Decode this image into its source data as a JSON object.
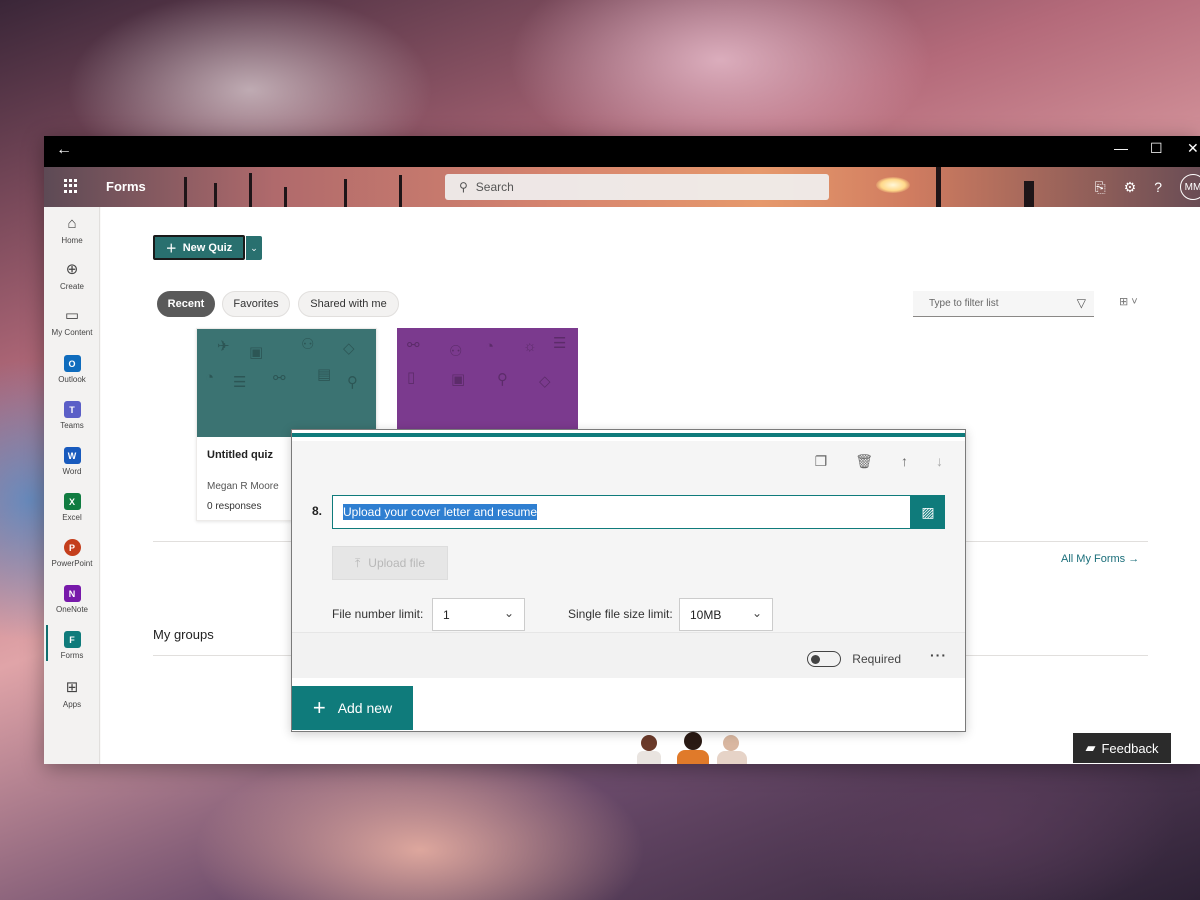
{
  "window": {
    "back_icon": "back-arrow-icon",
    "controls": [
      "minimize-icon",
      "maximize-icon",
      "close-icon"
    ]
  },
  "appbar": {
    "app_name": "Forms",
    "search_placeholder": "Search",
    "avatar_initials": "MM",
    "icons": [
      "app-launcher-icon",
      "search-icon",
      "whats-new-icon",
      "settings-icon",
      "help-icon"
    ]
  },
  "rail": {
    "items": [
      {
        "label": "Home",
        "icon": "home-icon"
      },
      {
        "label": "Create",
        "icon": "create-icon"
      },
      {
        "label": "My Content",
        "icon": "folder-icon"
      },
      {
        "label": "Outlook",
        "icon": "outlook-icon",
        "badge": "O",
        "color": "#0f6cbd"
      },
      {
        "label": "Teams",
        "icon": "teams-icon",
        "badge": "T",
        "color": "#5b5fc7"
      },
      {
        "label": "Word",
        "icon": "word-icon",
        "badge": "W",
        "color": "#185abd"
      },
      {
        "label": "Excel",
        "icon": "excel-icon",
        "badge": "X",
        "color": "#107c41"
      },
      {
        "label": "PowerPoint",
        "icon": "powerpoint-icon",
        "badge": "P",
        "color": "#c43e1c"
      },
      {
        "label": "OneNote",
        "icon": "onenote-icon",
        "badge": "N",
        "color": "#7719aa"
      },
      {
        "label": "Forms",
        "icon": "forms-icon",
        "badge": "F",
        "color": "#0f7b7b"
      },
      {
        "label": "Apps",
        "icon": "apps-icon"
      }
    ]
  },
  "main": {
    "new_button_label": "New Quiz",
    "tabs": [
      {
        "label": "Recent",
        "active": true
      },
      {
        "label": "Favorites",
        "active": false
      },
      {
        "label": "Shared with me",
        "active": false
      }
    ],
    "filter_placeholder": "Type to filter list",
    "cards": [
      {
        "title": "Untitled quiz",
        "owner": "Megan R Moore",
        "responses": "0 responses",
        "color": "#3b7372"
      },
      {
        "title": "",
        "owner": "",
        "responses": "",
        "color": "#7b3a8e"
      }
    ],
    "all_forms_link": "All My Forms →",
    "my_groups_heading": "My groups"
  },
  "dialog": {
    "question_number": "8.",
    "question_text": "Upload your cover letter and resume",
    "upload_button": "Upload file",
    "file_number_label": "File number limit:",
    "file_number_value": "1",
    "file_size_label": "Single file size limit:",
    "file_size_value": "10MB",
    "required_label": "Required",
    "required_on": false,
    "add_new_label": "Add new",
    "accent_color": "#0f7b7b"
  },
  "feedback_label": "Feedback"
}
